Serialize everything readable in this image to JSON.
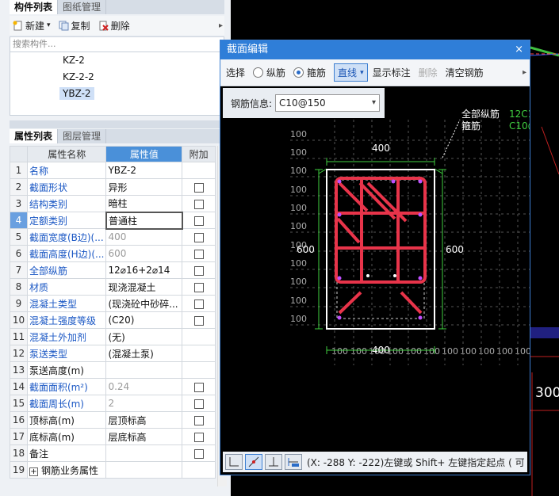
{
  "top_tabs": [
    "构件列表",
    "图纸管理"
  ],
  "toolbar": {
    "new_label": "新建",
    "copy_label": "复制",
    "delete_label": "删除",
    "more_glyph": "▸"
  },
  "search": {
    "placeholder": "搜索构件..."
  },
  "components": [
    {
      "name": "KZ-2",
      "selected": false
    },
    {
      "name": "KZ-2-2",
      "selected": false
    },
    {
      "name": "YBZ-2",
      "selected": true
    }
  ],
  "prop_tabs": [
    "属性列表",
    "图层管理"
  ],
  "prop_headers": {
    "name": "属性名称",
    "value": "属性值",
    "extra": "附加"
  },
  "properties": [
    {
      "n": "1",
      "name": "名称",
      "value": "YBZ-2",
      "blue": true,
      "gray": false,
      "cb": false
    },
    {
      "n": "2",
      "name": "截面形状",
      "value": "异形",
      "blue": true,
      "gray": false,
      "cb": true
    },
    {
      "n": "3",
      "name": "结构类别",
      "value": "暗柱",
      "blue": true,
      "gray": false,
      "cb": true
    },
    {
      "n": "4",
      "name": "定额类别",
      "value": "普通柱",
      "blue": true,
      "gray": false,
      "cb": true,
      "editing": true
    },
    {
      "n": "5",
      "name": "截面宽度(B边)(...",
      "value": "400",
      "blue": true,
      "gray": true,
      "cb": true
    },
    {
      "n": "6",
      "name": "截面高度(H边)(...",
      "value": "600",
      "blue": true,
      "gray": true,
      "cb": true
    },
    {
      "n": "7",
      "name": "全部纵筋",
      "value": "12⌀16+2⌀14",
      "blue": true,
      "gray": false,
      "cb": true
    },
    {
      "n": "8",
      "name": "材质",
      "value": "现浇混凝土",
      "blue": true,
      "gray": false,
      "cb": true
    },
    {
      "n": "9",
      "name": "混凝土类型",
      "value": "(现浇砼中砂碎...",
      "blue": true,
      "gray": false,
      "cb": true
    },
    {
      "n": "10",
      "name": "混凝土强度等级",
      "value": "(C20)",
      "blue": true,
      "gray": false,
      "cb": true
    },
    {
      "n": "11",
      "name": "混凝土外加剂",
      "value": "(无)",
      "blue": true,
      "gray": false,
      "cb": false
    },
    {
      "n": "12",
      "name": "泵送类型",
      "value": "(混凝土泵)",
      "blue": true,
      "gray": false,
      "cb": false
    },
    {
      "n": "13",
      "name": "泵送高度(m)",
      "value": "",
      "blue": false,
      "gray": false,
      "cb": false
    },
    {
      "n": "14",
      "name": "截面面积(m²)",
      "value": "0.24",
      "blue": true,
      "gray": true,
      "cb": true
    },
    {
      "n": "15",
      "name": "截面周长(m)",
      "value": "2",
      "blue": true,
      "gray": true,
      "cb": true
    },
    {
      "n": "16",
      "name": "顶标高(m)",
      "value": "层顶标高",
      "blue": false,
      "gray": false,
      "cb": true
    },
    {
      "n": "17",
      "name": "底标高(m)",
      "value": "层底标高",
      "blue": false,
      "gray": false,
      "cb": true
    },
    {
      "n": "18",
      "name": "备注",
      "value": "",
      "blue": false,
      "gray": false,
      "cb": true
    },
    {
      "n": "19",
      "name": "钢筋业务属性",
      "value": "",
      "blue": false,
      "gray": false,
      "cb": false,
      "plus": true
    }
  ],
  "dialog": {
    "title": "截面编辑",
    "close": "×",
    "tools": {
      "select": "选择",
      "longitudinal": "纵筋",
      "stirrup": "箍筋",
      "line": "直线",
      "show_label": "显示标注",
      "delete": "删除",
      "clear": "清空钢筋",
      "more": "▸"
    },
    "rebar_info_label": "钢筋信息:",
    "rebar_info_value": "C10@150",
    "legend": {
      "all_long": "全部纵筋",
      "stirrup": "箍筋",
      "long_val": "12C1",
      "stirrup_val": "C10@"
    },
    "dims": {
      "width": "400",
      "height": "600",
      "grid": "100"
    },
    "status": "(X: -288 Y: -222)左键或 Shift+ 左键指定起点 ( 可"
  },
  "background": {
    "label": "300"
  },
  "colors": {
    "accent": "#2f7ed8",
    "rebar": "#e8344a",
    "dim": "#40d040",
    "link": "#1a57c4"
  }
}
